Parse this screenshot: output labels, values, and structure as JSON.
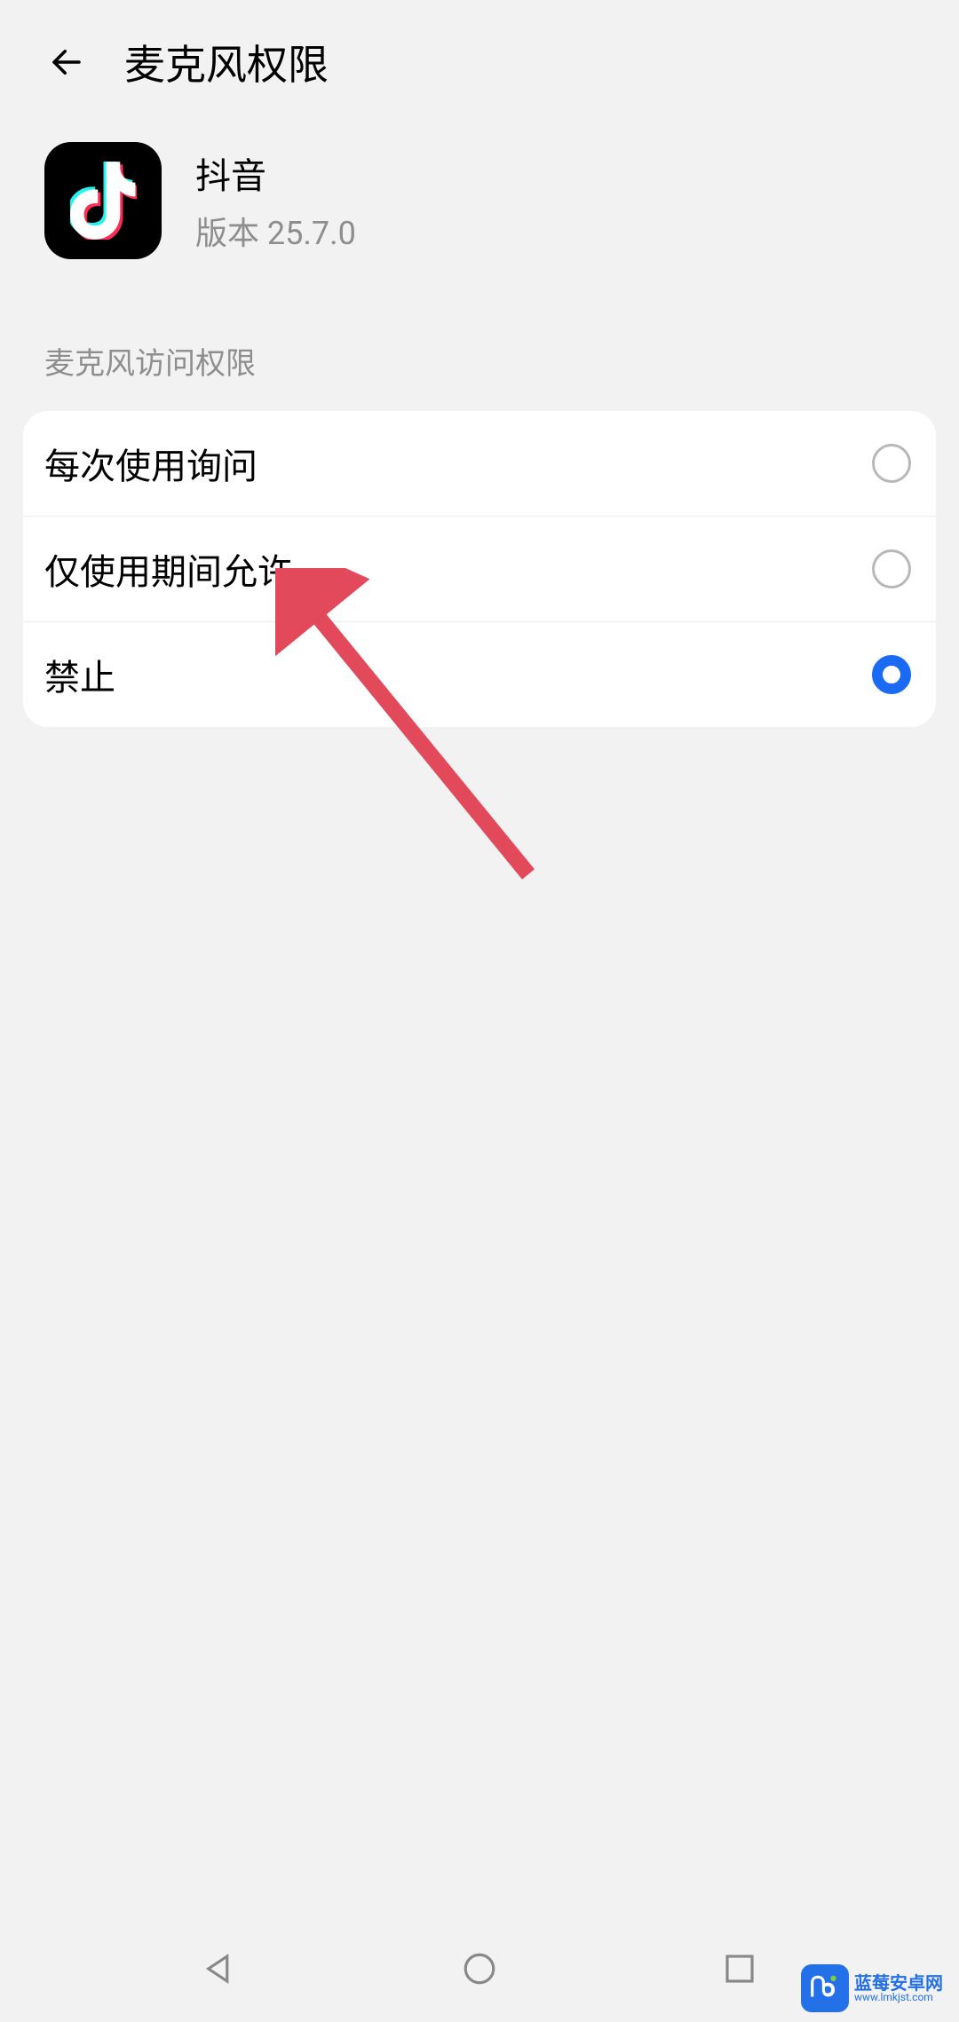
{
  "header": {
    "title": "麦克风权限"
  },
  "app": {
    "name": "抖音",
    "version": "版本 25.7.0"
  },
  "section": {
    "label": "麦克风访问权限"
  },
  "options": [
    {
      "label": "每次使用询问",
      "selected": false
    },
    {
      "label": "仅使用期间允许",
      "selected": false
    },
    {
      "label": "禁止",
      "selected": true
    }
  ],
  "watermark": {
    "title": "蓝莓安卓网",
    "url": "www.lmkjst.com"
  }
}
